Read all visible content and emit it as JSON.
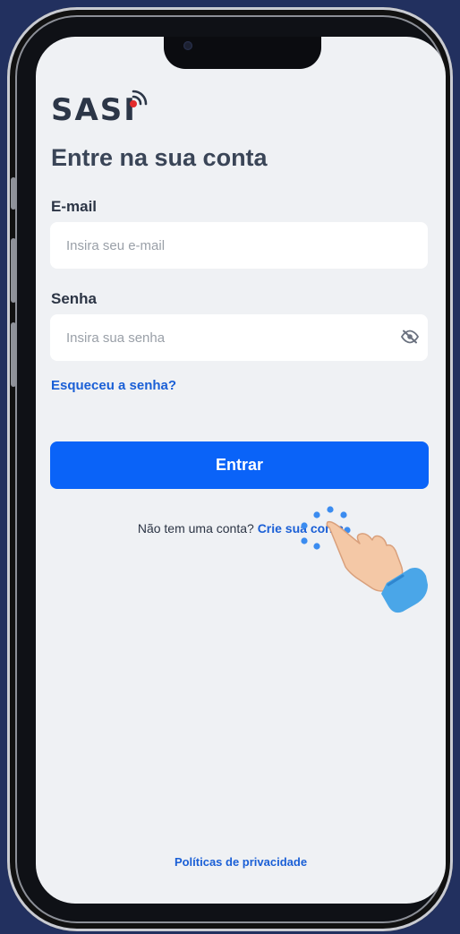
{
  "app": {
    "logo_text": "SASI",
    "logo_icon": "signal-icon"
  },
  "login": {
    "title": "Entre na sua conta",
    "email_label": "E-mail",
    "email_placeholder": "Insira seu e-mail",
    "email_value": "",
    "password_label": "Senha",
    "password_placeholder": "Insira sua senha",
    "password_value": "",
    "password_toggle_icon": "eye-off-icon",
    "forgot_link": "Esqueceu a senha?",
    "submit_label": "Entrar",
    "signup_question": "Não tem uma conta?",
    "signup_link": "Crie sua conta",
    "privacy_link": "Políticas de privacidade"
  },
  "colors": {
    "accent": "#0a63f8",
    "link": "#1a5fd6",
    "background": "#eff1f4",
    "logo_dot": "#e32b2b"
  },
  "overlay": {
    "pointer_icon": "tap-hand-icon"
  }
}
